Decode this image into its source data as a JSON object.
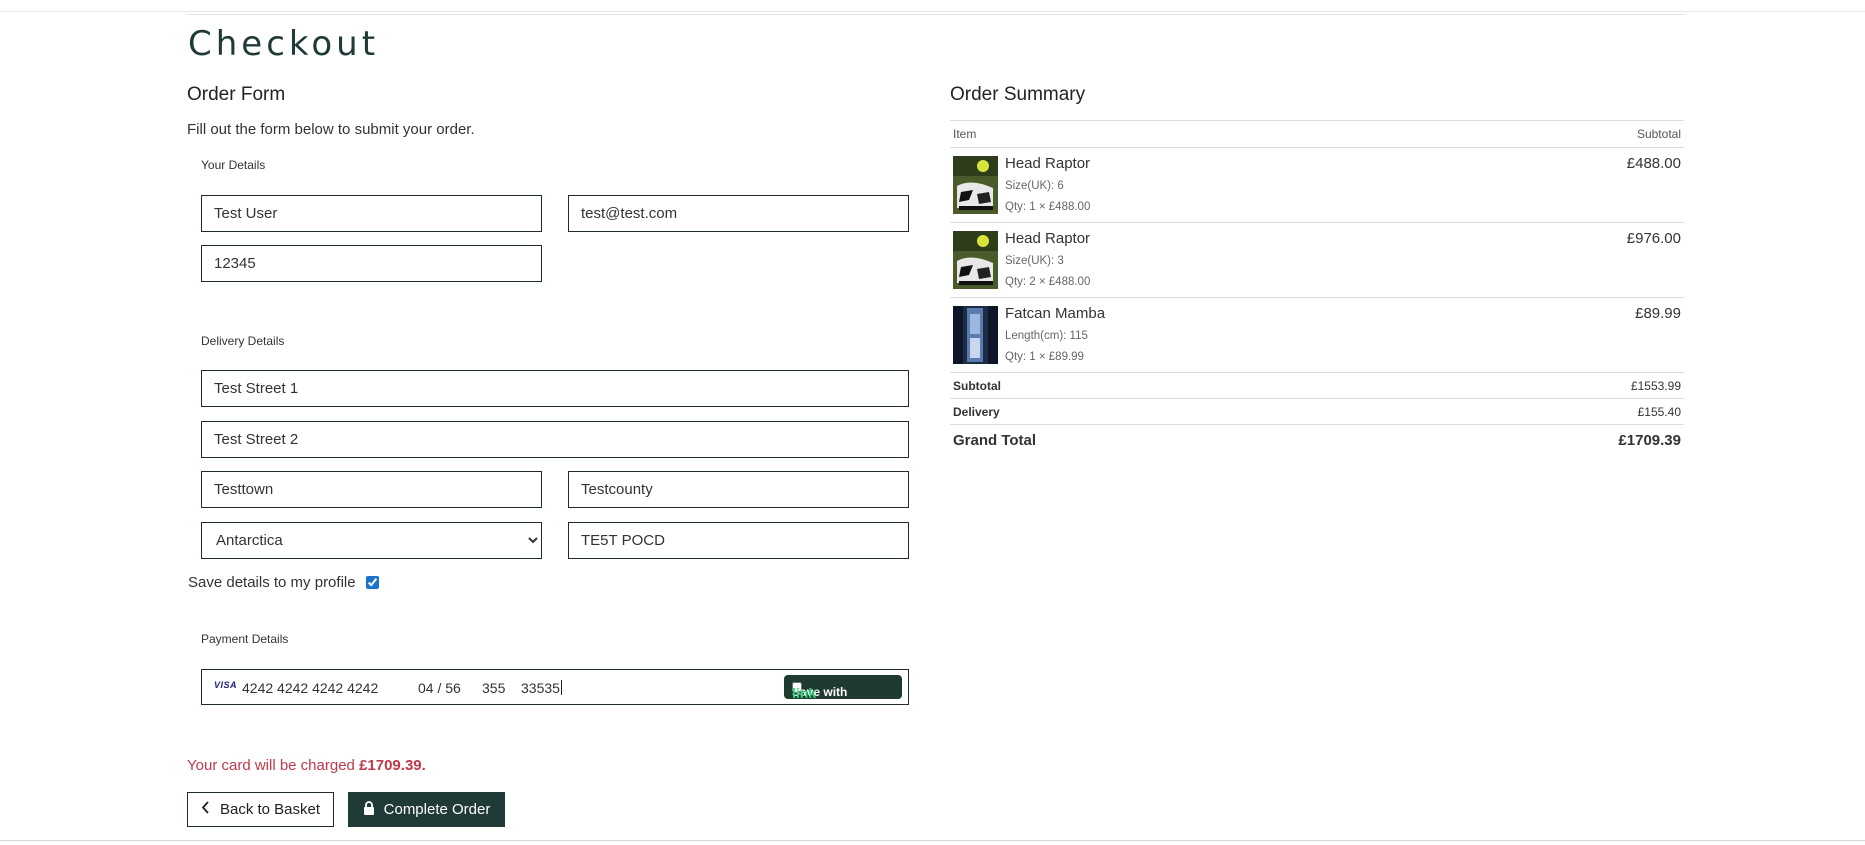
{
  "page_title": "Checkout",
  "order_form": {
    "heading": "Order Form",
    "intro": "Fill out the form below to submit your order.",
    "your_details": {
      "label": "Your Details",
      "full_name": "Test User",
      "email": "test@test.com",
      "phone": "12345"
    },
    "delivery_details": {
      "label": "Delivery Details",
      "street1": "Test Street 1",
      "street2": "Test Street 2",
      "town": "Testtown",
      "county": "Testcounty",
      "country": "Antarctica",
      "postcode": "TE5T POCD"
    },
    "save_details_label": "Save details to my profile",
    "save_details_checked": true,
    "payment_details": {
      "label": "Payment Details",
      "card_brand": "VISA",
      "card_number": "4242 4242 4242 4242",
      "expiry": "04 / 56",
      "cvc": "355",
      "zip": "33535",
      "link_save_label": "Save with",
      "link_brand": "link"
    },
    "charge_text": "Your card will be charged",
    "charge_amount": "£1709.39.",
    "back_button": "Back to Basket",
    "complete_button": "Complete Order"
  },
  "order_summary": {
    "heading": "Order Summary",
    "col_item": "Item",
    "col_subtotal": "Subtotal",
    "items": [
      {
        "name": "Head Raptor",
        "variant": "Size(UK): 6",
        "qty": "Qty: 1 × £488.00",
        "subtotal": "£488.00"
      },
      {
        "name": "Head Raptor",
        "variant": "Size(UK): 3",
        "qty": "Qty: 2 × £488.00",
        "subtotal": "£976.00"
      },
      {
        "name": "Fatcan Mamba",
        "variant": "Length(cm): 115",
        "qty": "Qty: 1 × £89.99",
        "subtotal": "£89.99"
      }
    ],
    "subtotal_label": "Subtotal",
    "subtotal_value": "£1553.99",
    "delivery_label": "Delivery",
    "delivery_value": "£155.40",
    "grand_total_label": "Grand Total",
    "grand_total_value": "£1709.39"
  },
  "colors": {
    "brand_dark": "#1f3a37",
    "charge_text": "#c0394b",
    "link_green": "#33d17a"
  }
}
